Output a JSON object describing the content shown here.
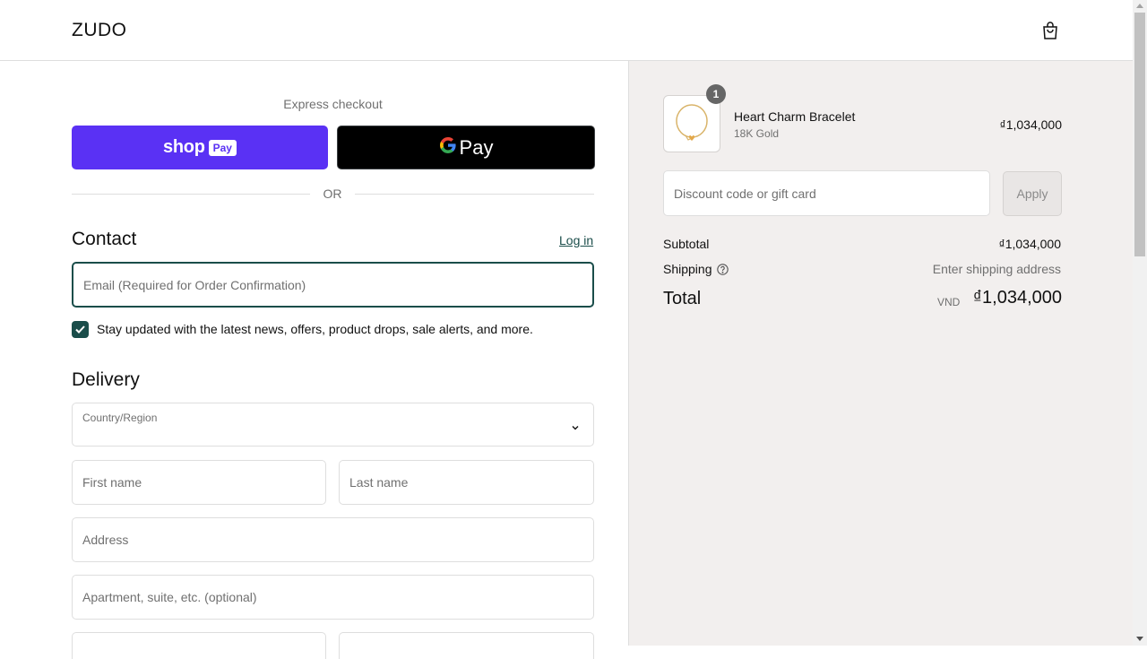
{
  "header": {
    "logo": "ZUDO",
    "bag_icon": "shopping-bag-icon"
  },
  "express": {
    "title": "Express checkout",
    "shop_label": "shop",
    "shop_pay_label": "Pay",
    "gpay_g": "G",
    "gpay_label": "Pay",
    "shop_color": "#5a31f4",
    "or": "OR"
  },
  "contact": {
    "heading": "Contact",
    "login": "Log in",
    "email_placeholder": "Email (Required for Order Confirmation)",
    "newsletter_checked": true,
    "newsletter_label": "Stay updated with the latest news, offers, product drops, sale alerts, and more."
  },
  "delivery": {
    "heading": "Delivery",
    "country_label": "Country/Region",
    "country_value": "",
    "first_name_placeholder": "First name",
    "last_name_placeholder": "Last name",
    "address_placeholder": "Address",
    "apartment_placeholder": "Apartment, suite, etc. (optional)"
  },
  "summary": {
    "item": {
      "quantity": "1",
      "name": "Heart Charm Bracelet",
      "variant": "18K Gold",
      "price": "₫1,034,000"
    },
    "discount_placeholder": "Discount code or gift card",
    "apply_label": "Apply",
    "subtotal_label": "Subtotal",
    "subtotal_value": "₫1,034,000",
    "shipping_label": "Shipping",
    "shipping_value": "Enter shipping address",
    "total_label": "Total",
    "currency": "VND",
    "total_value": "₫1,034,000"
  },
  "colors": {
    "accent": "#1a4d4a",
    "sidebar_bg": "#f2efee"
  }
}
